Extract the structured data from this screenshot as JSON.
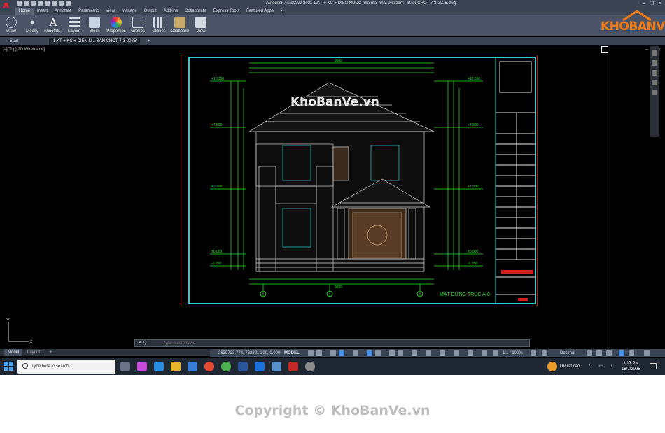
{
  "app": {
    "logo": "A",
    "window_title": "Autodesk AutoCAD 2021    1.KT + KC + DIEN NUOC nha mai nhat 9.5x11m - BAN CHOT 7-3-2025.dwg",
    "window_controls": [
      "–",
      "❐",
      "✕"
    ]
  },
  "ribbon": {
    "tabs": [
      "Home",
      "Insert",
      "Annotate",
      "Parametric",
      "View",
      "Manage",
      "Output",
      "Add-ins",
      "Collaborate",
      "Express Tools",
      "Featured Apps",
      "▪▾"
    ],
    "panels": [
      "Draw",
      "Modify",
      "Annotati...",
      "Layers",
      "Block",
      "Properties",
      "Groups",
      "Utilities",
      "Clipboard",
      "View"
    ]
  },
  "doc_tabs": {
    "start": "Start",
    "drawing": "1.KT + KC + DIEN N... BAN CHOT 7-3-2025*",
    "add": "+"
  },
  "viewport": {
    "label": "[–][Top][2D Wireframe]",
    "controls": [
      "–",
      "❐",
      "✕"
    ]
  },
  "drawing": {
    "elevation_title": "MẶT ĐỨNG TRỤC A-8",
    "levels": [
      "+10.350",
      "+7.500",
      "+3.900",
      "±0.000",
      "-0.750"
    ],
    "levels_right": [
      "+10.350",
      "+7.500",
      "+3.900",
      "±0.000",
      "-0.750"
    ],
    "dim_total": "9600",
    "dim_bottom": "9600"
  },
  "command": {
    "close": "✕ ⚲",
    "placeholder": "Type a command"
  },
  "layout_tabs": [
    "Model",
    "Layout1",
    "+"
  ],
  "status": {
    "coords": "2839723.774, 762821.300, 0.000",
    "model": "MODEL",
    "scale": "1:1 / 100%",
    "units": "Decimal"
  },
  "taskbar": {
    "search_placeholder": "Type here to search",
    "weather": "UV rất cao",
    "tray": "^ ▭ ♪",
    "time": "3:17 PM",
    "date": "18/7/2025"
  },
  "watermarks": {
    "brand": "KHOBANVE",
    "center": "KhoBanVe.vn",
    "copyright": "Copyright © KhoBanVe.vn"
  },
  "colors": {
    "drawing_green": "#2ee62e",
    "frame_cyan": "#2bd1d1",
    "brand_orange": "#f07b14"
  }
}
